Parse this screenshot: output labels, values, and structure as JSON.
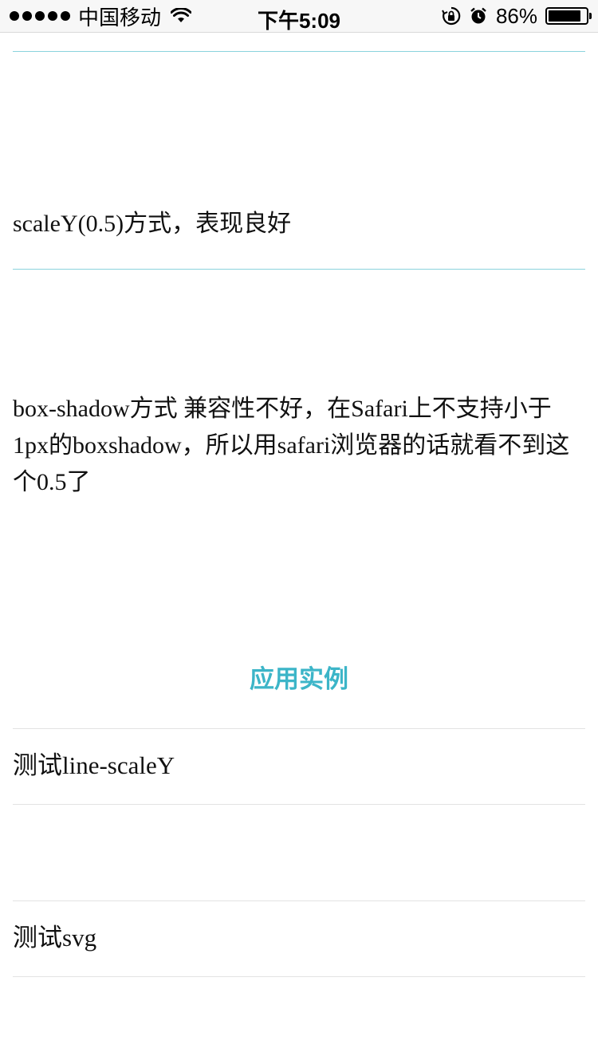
{
  "status_bar": {
    "carrier": "中国移动",
    "time": "下午5:09",
    "battery_text": "86%",
    "battery_level": 0.86,
    "icons": [
      "signal-dots-icon",
      "wifi-icon",
      "orientation-lock-icon",
      "alarm-icon",
      "battery-icon"
    ]
  },
  "content": {
    "para_scaley": "scaleY(0.5)方式，表现良好",
    "para_boxshadow": "box-shadow方式 兼容性不好，在Safari上不支持小于1px的boxshadow，所以用safari浏览器的话就看不到这个0.5了",
    "section_heading": "应用实例",
    "items": [
      {
        "label": "测试line-scaleY"
      },
      {
        "label": "测试svg"
      }
    ]
  },
  "colors": {
    "accent": "#3cb5c8",
    "teal_line": "#8ad3dd",
    "gray_line": "#e3e3e3"
  }
}
